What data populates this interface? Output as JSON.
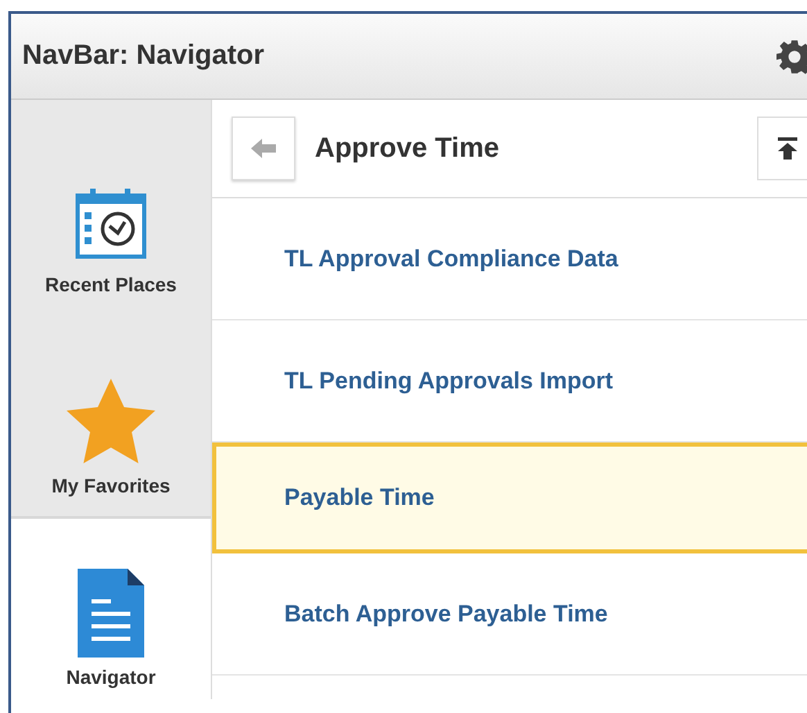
{
  "window": {
    "title": "NavBar: Navigator"
  },
  "sidebar": {
    "items": [
      {
        "label": "Recent Places",
        "kind": "recent",
        "selected": false
      },
      {
        "label": "My Favorites",
        "kind": "favorites",
        "selected": false
      },
      {
        "label": "Navigator",
        "kind": "navigator",
        "selected": true
      }
    ]
  },
  "content": {
    "title": "Approve Time",
    "items": [
      {
        "label": "TL Approval Compliance Data",
        "selected": false
      },
      {
        "label": "TL Pending Approvals Import",
        "selected": false
      },
      {
        "label": "Payable Time",
        "selected": true
      },
      {
        "label": "Batch Approve Payable Time",
        "selected": false
      }
    ]
  }
}
